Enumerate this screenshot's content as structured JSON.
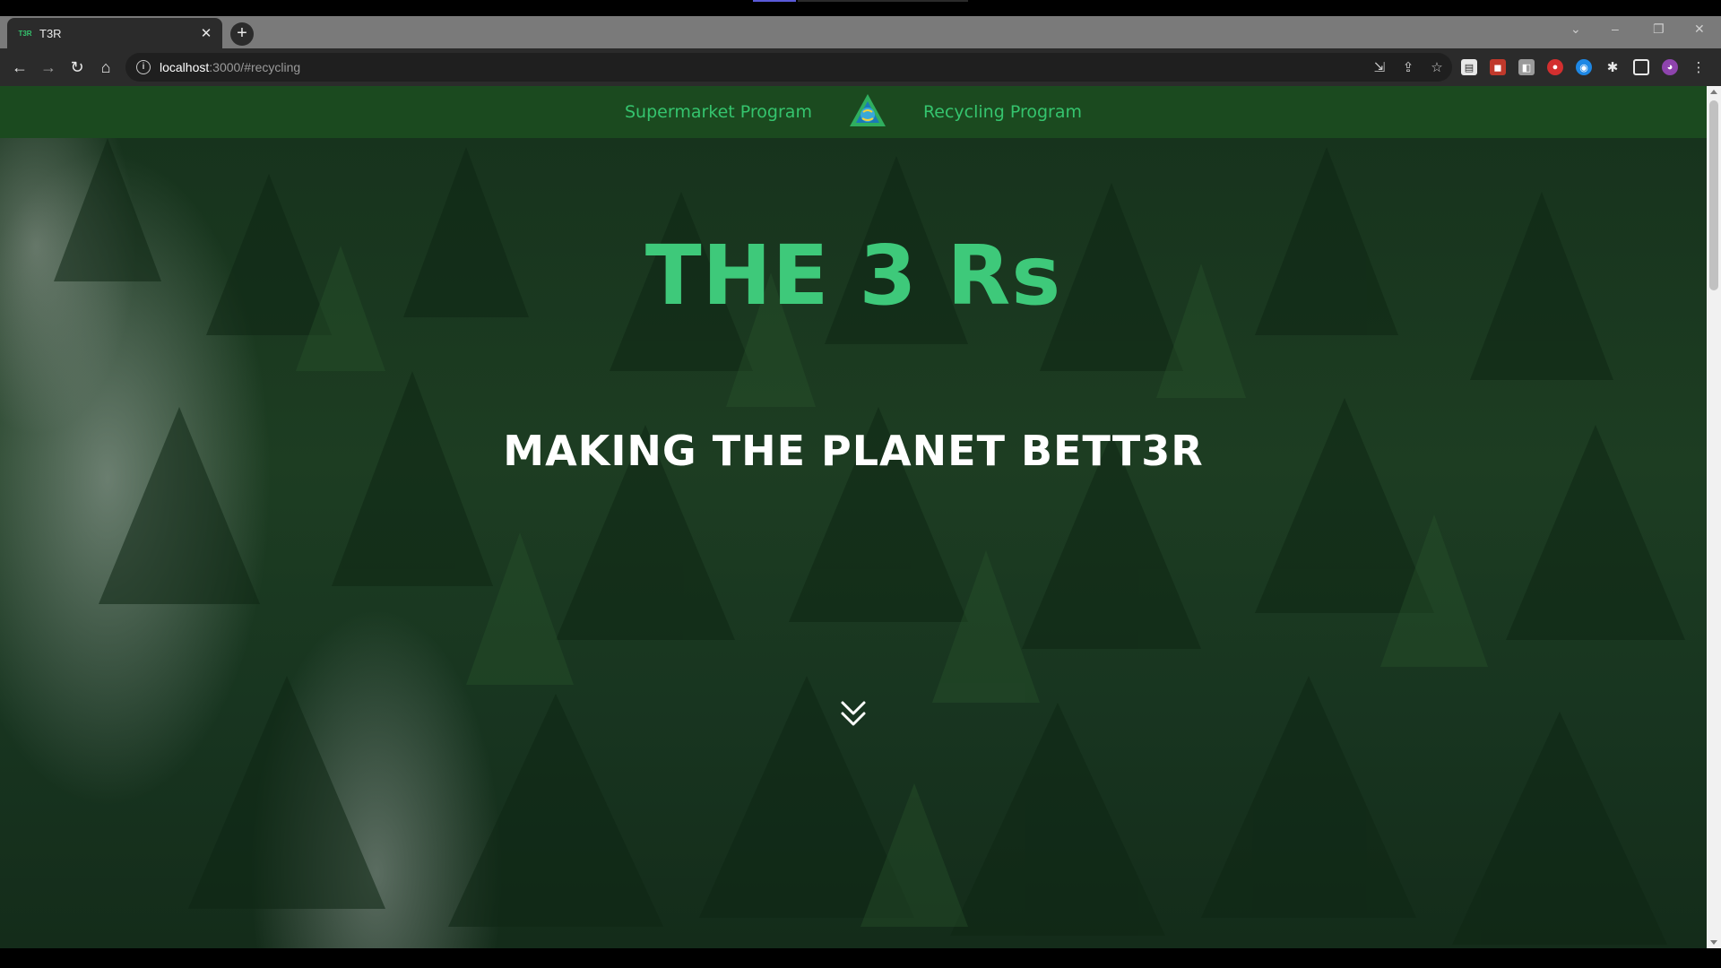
{
  "browser": {
    "tab": {
      "favicon_text": "T3R",
      "title": "T3R"
    },
    "address": {
      "host": "localhost",
      "path": ":3000/#recycling"
    }
  },
  "site": {
    "nav": {
      "left_link": "Supermarket Program",
      "right_link": "Recycling Program",
      "logo_text": "T3R"
    },
    "hero": {
      "title": "THE 3 Rs",
      "subtitle": "MAKING THE PLANET BETT3R"
    }
  },
  "colors": {
    "accent_green": "#3ec97a",
    "nav_bg": "#1b4a1f"
  },
  "icons": {
    "scroll": "double-chevron-down-icon"
  }
}
